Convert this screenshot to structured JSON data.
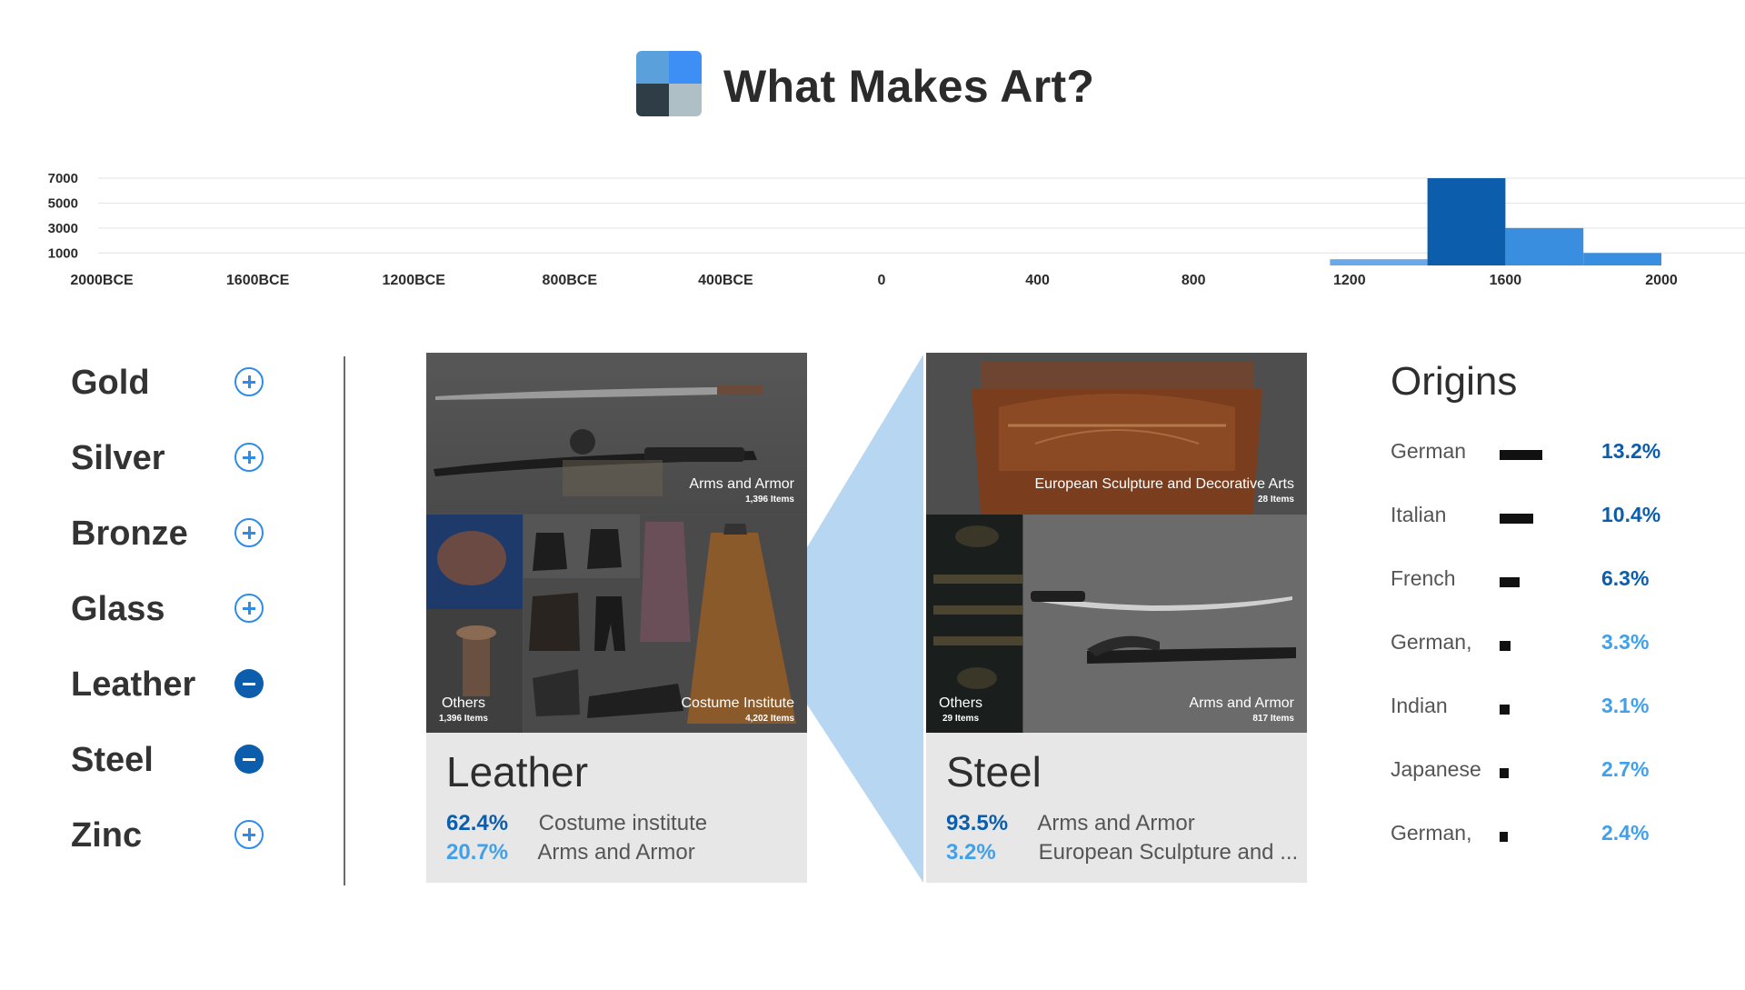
{
  "header": {
    "title": "What Makes Art?",
    "logo_icon": "logo-grid-icon"
  },
  "timeline": {
    "chart_data": {
      "type": "bar",
      "title": "",
      "xlabel": "",
      "ylabel": "",
      "x_ticks": [
        "2000BCE",
        "1600BCE",
        "1200BCE",
        "800BCE",
        "400BCE",
        "0",
        "400",
        "800",
        "1200",
        "1600",
        "2000"
      ],
      "y_ticks": [
        "7000",
        "5000",
        "3000",
        "1000"
      ],
      "bins": [
        {
          "start": 1150,
          "end": 1400,
          "value": 500
        },
        {
          "start": 1400,
          "end": 1600,
          "value": 7000
        },
        {
          "start": 1600,
          "end": 1800,
          "value": 3000
        },
        {
          "start": 1800,
          "end": 2000,
          "value": 1000
        }
      ],
      "highlight_bin": 1,
      "colors": {
        "bin": "#69a9e8",
        "highlight": "#0c5dab",
        "light": "#3a8ee0"
      },
      "ylim": [
        0,
        7000
      ],
      "grid": true
    }
  },
  "materials": [
    {
      "label": "Gold",
      "state": "add",
      "icon": "plus-circle-icon"
    },
    {
      "label": "Silver",
      "state": "add",
      "icon": "plus-circle-icon"
    },
    {
      "label": "Bronze",
      "state": "add",
      "icon": "plus-circle-icon"
    },
    {
      "label": "Glass",
      "state": "add",
      "icon": "plus-circle-icon"
    },
    {
      "label": "Leather",
      "state": "remove",
      "icon": "minus-circle-icon"
    },
    {
      "label": "Steel",
      "state": "remove",
      "icon": "minus-circle-icon"
    },
    {
      "label": "Zinc",
      "state": "add",
      "icon": "plus-circle-icon"
    }
  ],
  "cards": {
    "leather": {
      "name": "Leather",
      "tiles": {
        "top": {
          "name": "Arms and Armor",
          "count": "1,396 Items"
        },
        "others": {
          "name": "Others",
          "count": "1,396 Items"
        },
        "main": {
          "name": "Costume Institute",
          "count": "4,202 Items"
        }
      },
      "rows": [
        {
          "pct": "62.4%",
          "dept": "Costume institute"
        },
        {
          "pct": "20.7%",
          "dept": "Arms and Armor"
        }
      ]
    },
    "steel": {
      "name": "Steel",
      "tiles": {
        "top": {
          "name": "European Sculpture and Decorative Arts",
          "count": "28 Items"
        },
        "others": {
          "name": "Others",
          "count": "29 Items"
        },
        "main": {
          "name": "Arms and Armor",
          "count": "817 Items"
        }
      },
      "rows": [
        {
          "pct": "93.5%",
          "dept": "Arms and Armor"
        },
        {
          "pct": "3.2%",
          "dept": "European Sculpture and ..."
        }
      ]
    }
  },
  "origins": {
    "heading": "Origins",
    "items": [
      {
        "name": "German",
        "pct": "13.2%",
        "value": 13.2,
        "tone": "dark"
      },
      {
        "name": "Italian",
        "pct": "10.4%",
        "value": 10.4,
        "tone": "dark"
      },
      {
        "name": "French",
        "pct": "6.3%",
        "value": 6.3,
        "tone": "dark"
      },
      {
        "name": "German,",
        "pct": "3.3%",
        "value": 3.3,
        "tone": "light"
      },
      {
        "name": "Indian",
        "pct": "3.1%",
        "value": 3.1,
        "tone": "light"
      },
      {
        "name": "Japanese",
        "pct": "2.7%",
        "value": 2.7,
        "tone": "light"
      },
      {
        "name": "German,",
        "pct": "2.4%",
        "value": 2.4,
        "tone": "light"
      }
    ]
  }
}
